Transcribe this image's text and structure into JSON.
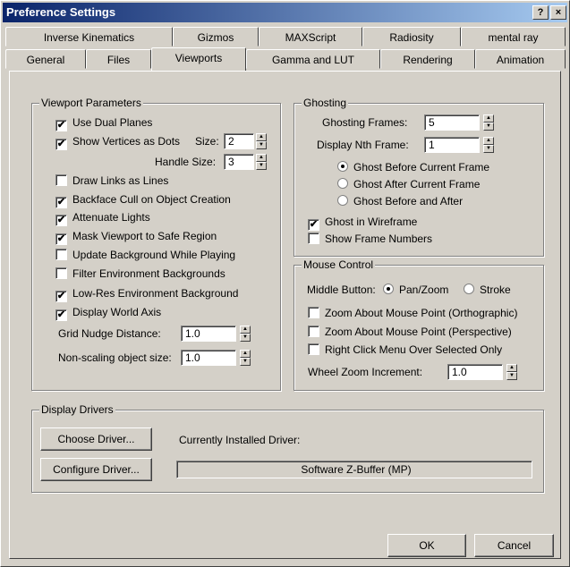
{
  "window": {
    "title": "Preference Settings",
    "help_label": "?",
    "close_label": "×"
  },
  "tabs_row1": [
    "Inverse Kinematics",
    "Gizmos",
    "MAXScript",
    "Radiosity",
    "mental ray"
  ],
  "tabs_row2": [
    "General",
    "Files",
    "Viewports",
    "Gamma and LUT",
    "Rendering",
    "Animation"
  ],
  "selected_tab": "Viewports",
  "viewport_params": {
    "label": "Viewport Parameters",
    "use_dual_planes": {
      "label": "Use Dual Planes",
      "checked": true
    },
    "show_vertices": {
      "label": "Show Vertices as Dots",
      "checked": true
    },
    "size_label": "Size:",
    "size_value": "2",
    "handle_size_label": "Handle Size:",
    "handle_size_value": "3",
    "draw_links": {
      "label": "Draw Links as Lines",
      "checked": false
    },
    "backface_cull": {
      "label": "Backface Cull on Object Creation",
      "checked": true
    },
    "attenuate_lights": {
      "label": "Attenuate Lights",
      "checked": true
    },
    "mask_viewport": {
      "label": "Mask Viewport to Safe Region",
      "checked": true
    },
    "update_background": {
      "label": "Update Background While Playing",
      "checked": false
    },
    "filter_env": {
      "label": "Filter Environment Backgrounds",
      "checked": false
    },
    "lowres_env": {
      "label": "Low-Res Environment Background",
      "checked": true
    },
    "display_world_axis": {
      "label": "Display World Axis",
      "checked": true
    },
    "grid_nudge_label": "Grid Nudge Distance:",
    "grid_nudge_value": "1.0",
    "nonscaling_label": "Non-scaling object size:",
    "nonscaling_value": "1.0"
  },
  "ghosting": {
    "label": "Ghosting",
    "frames_label": "Ghosting Frames:",
    "frames_value": "5",
    "nth_label": "Display Nth Frame:",
    "nth_value": "1",
    "before": {
      "label": "Ghost Before Current Frame",
      "selected": true
    },
    "after": {
      "label": "Ghost After Current Frame",
      "selected": false
    },
    "both": {
      "label": "Ghost Before and After",
      "selected": false
    },
    "wireframe": {
      "label": "Ghost in Wireframe",
      "checked": true
    },
    "show_numbers": {
      "label": "Show Frame Numbers",
      "checked": false
    }
  },
  "mouse": {
    "label": "Mouse Control",
    "middle_label": "Middle Button:",
    "panzoom": {
      "label": "Pan/Zoom",
      "selected": true
    },
    "stroke": {
      "label": "Stroke",
      "selected": false
    },
    "zoom_ortho": {
      "label": "Zoom About Mouse Point (Orthographic)",
      "checked": false
    },
    "zoom_persp": {
      "label": "Zoom About Mouse Point (Perspective)",
      "checked": false
    },
    "right_click": {
      "label": "Right Click Menu Over Selected Only",
      "checked": false
    },
    "wheel_label": "Wheel Zoom Increment:",
    "wheel_value": "1.0"
  },
  "drivers": {
    "label": "Display Drivers",
    "choose_label": "Choose Driver...",
    "configure_label": "Configure Driver...",
    "current_label": "Currently Installed Driver:",
    "current_value": "Software Z-Buffer (MP)"
  },
  "footer": {
    "ok_label": "OK",
    "cancel_label": "Cancel"
  },
  "colors": {
    "titlebar_start": "#0a246a",
    "titlebar_end": "#a6caf0",
    "face": "#d4d0c8"
  }
}
